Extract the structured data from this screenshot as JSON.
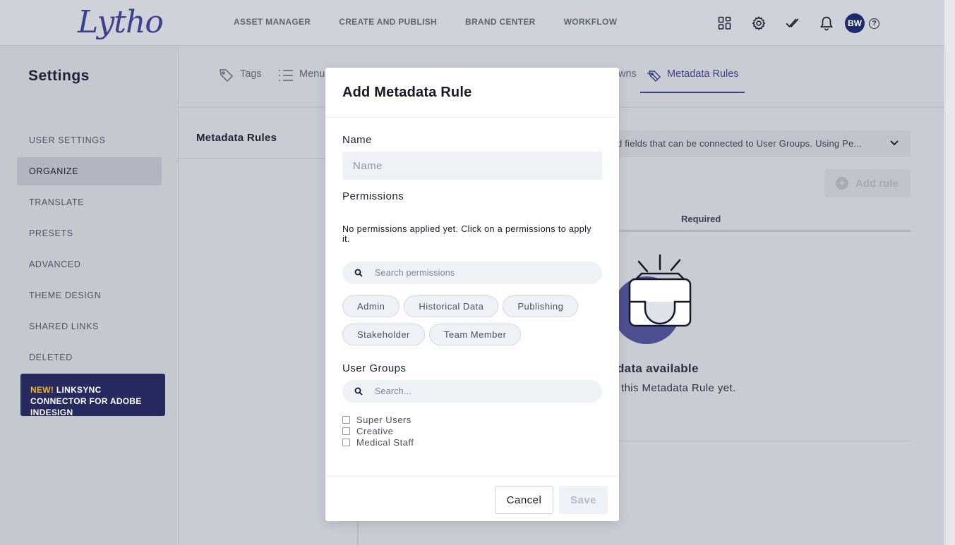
{
  "app": {
    "logo": "Lytho",
    "nav": [
      "ASSET MANAGER",
      "CREATE AND PUBLISH",
      "BRAND CENTER",
      "WORKFLOW"
    ],
    "user_initials": "BW",
    "help_symbol": "?"
  },
  "sidebar": {
    "title": "Settings",
    "items": [
      {
        "label": "USER SETTINGS"
      },
      {
        "label": "ORGANIZE"
      },
      {
        "label": "TRANSLATE"
      },
      {
        "label": "PRESETS"
      },
      {
        "label": "ADVANCED"
      },
      {
        "label": "THEME DESIGN"
      },
      {
        "label": "SHARED LINKS"
      },
      {
        "label": "DELETED"
      }
    ],
    "active_index": 1,
    "promo": {
      "new": "NEW!",
      "text": " LINKSYNC CONNECTOR FOR ADOBE INDESIGN"
    }
  },
  "tabs": {
    "tags": "Tags",
    "menu": "Menu",
    "partial": "wns",
    "metadata_rules": "Metadata Rules"
  },
  "subpanel": {
    "title": "Metadata Rules"
  },
  "background": {
    "info": "d fields that can be connected to User Groups. Using Pe...",
    "add_rule": "Add rule",
    "required_header": "Required",
    "empty_title": "data available",
    "empty_sub": "this Metadata Rule yet."
  },
  "modal": {
    "title": "Add Metadata Rule",
    "name_label": "Name",
    "name_value": "",
    "name_placeholder": "Name",
    "permissions_label": "Permissions",
    "no_permissions": "No permissions applied yet. Click on a permissions to apply it.",
    "search_permissions_placeholder": "Search permissions",
    "permission_chips": [
      "Admin",
      "Historical Data",
      "Publishing",
      "Stakeholder",
      "Team Member"
    ],
    "user_groups_label": "User Groups",
    "user_groups_search_placeholder": "Search...",
    "user_groups": [
      {
        "label": "Super Users",
        "checked": false
      },
      {
        "label": "Creative",
        "checked": false
      },
      {
        "label": "Medical Staff",
        "checked": false
      }
    ],
    "cancel": "Cancel",
    "save": "Save"
  },
  "colors": {
    "brand": "#3b418f",
    "promo_bg": "#272a5e",
    "promo_accent": "#f0b429",
    "avatar_bg": "#1c2a6e",
    "overlay": "#c9cdd3"
  }
}
